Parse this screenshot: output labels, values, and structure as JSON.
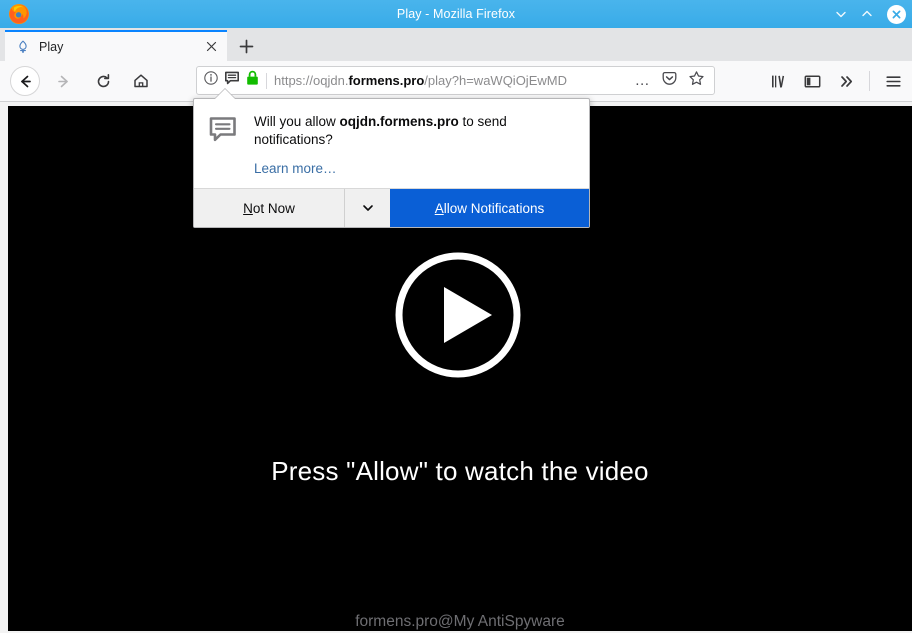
{
  "window": {
    "title": "Play - Mozilla Firefox",
    "app_icon": "firefox-logo-icon",
    "minimize_label": "⌄",
    "maximize_label": "⌃",
    "close_label": "✕"
  },
  "tabs": {
    "active": {
      "title": "Play",
      "favicon": "page-favicon-icon",
      "close_label": "✕"
    },
    "new_tab_label": "+"
  },
  "toolbar": {
    "back_label": "back-arrow",
    "forward_label": "forward-arrow",
    "reload_label": "reload-arrow",
    "home_label": "home-house",
    "library_label": "library-books",
    "sidebar_label": "sidebar-panel",
    "overflow_label": "»",
    "menu_label": "hamburger-menu",
    "page_actions_label": "…"
  },
  "urlbar": {
    "scheme": "https://",
    "subdomain": "oqjdn.",
    "domain": "formens.pro",
    "path": "/play?h=waWQiOjEwMD",
    "full_url": "https://oqjdn.formens.pro/play?h=waWQiOjEwMD",
    "identity_icon": "info-circle-icon",
    "notification_permission_icon": "speech-bubble-icon",
    "lock_icon": "green-padlock-icon",
    "lock_color": "#12bc00",
    "pocket_icon": "pocket-shield-icon",
    "bookmark_icon": "star-outline-icon"
  },
  "doorhanger": {
    "icon": "notification-bubble-icon",
    "question_prefix": "Will you allow ",
    "question_domain": "oqjdn.formens.pro",
    "question_suffix": " to send notifications?",
    "learn_more": "Learn more…",
    "not_now_accesskey": "N",
    "not_now_rest": "ot Now",
    "dropmarker": "⌄",
    "allow_accesskey": "A",
    "allow_rest": "llow Notifications",
    "primary_color": "#0a5fd6",
    "link_color": "#3a6ea5"
  },
  "page": {
    "background": "#000000",
    "play_button": "play-circle-icon",
    "headline": "Press \"Allow\" to watch the video",
    "watermark": "formens.pro@My AntiSpyware"
  }
}
